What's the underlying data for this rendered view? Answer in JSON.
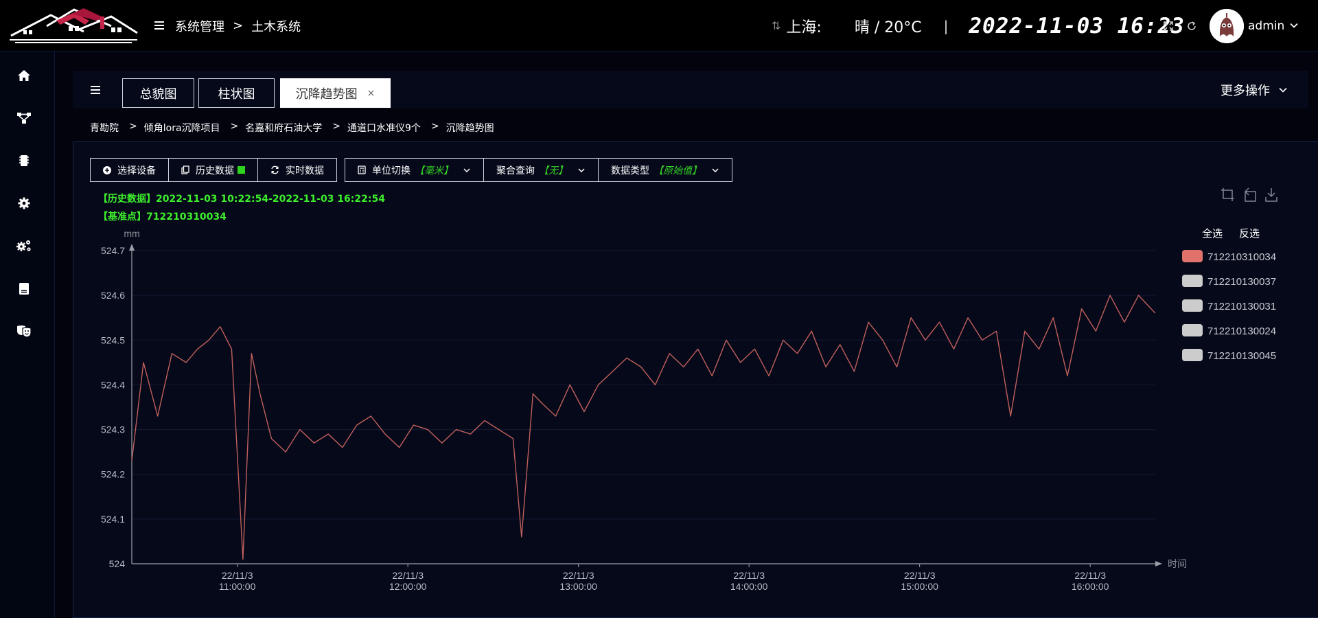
{
  "header": {
    "breadcrumb": [
      "系统管理",
      "土木系统"
    ],
    "breadcrumb_sep": ">",
    "city": "上海:",
    "weather": "晴 / 20°C",
    "divider": "|",
    "clock": "2022-11-03 16:23",
    "user": "admin"
  },
  "sidebar": {
    "items": [
      "home-icon",
      "topology-icon",
      "chip-icon",
      "gear-icon",
      "gears-icon",
      "book-icon",
      "theater-icon"
    ]
  },
  "tabs": {
    "items": [
      {
        "label": "总貌图"
      },
      {
        "label": "柱状图"
      },
      {
        "label": "沉降趋势图"
      }
    ],
    "close": "×",
    "more": "更多操作"
  },
  "breadcrumb": {
    "items": [
      "青勘院",
      "倾角lora沉降项目",
      "名嘉和府石油大学",
      "通道口水准仪9个",
      "沉降趋势图"
    ],
    "sep": ">"
  },
  "toolbar": {
    "select_device": "选择设备",
    "history": "历史数据",
    "realtime": "实时数据",
    "unit_label": "单位切换",
    "unit_value": "【毫米】",
    "agg_label": "聚合查询",
    "agg_value": "【无】",
    "dtype_label": "数据类型",
    "dtype_value": "【原始值】"
  },
  "info": {
    "history_range": "【历史数据】2022-11-03 10:22:54-2022-11-03 16:22:54",
    "reference": "【基准点】712210310034"
  },
  "legend": {
    "select_all": "全选",
    "invert": "反选",
    "items": [
      {
        "name": "712210310034",
        "color": "#e0716b"
      },
      {
        "name": "712210130037",
        "color": "#cccccc"
      },
      {
        "name": "712210130031",
        "color": "#cccccc"
      },
      {
        "name": "712210130024",
        "color": "#cccccc"
      },
      {
        "name": "712210130045",
        "color": "#cccccc"
      }
    ]
  },
  "chart_data": {
    "type": "line",
    "ylabel": "mm",
    "xlabel": "时间",
    "ylim": [
      524,
      524.7
    ],
    "yticks": [
      "524",
      "524.1",
      "524.2",
      "524.3",
      "524.4",
      "524.5",
      "524.6",
      "524.7"
    ],
    "xlim": [
      "2022-11-03 10:22:54",
      "2022-11-03 16:22:54"
    ],
    "xticks": [
      {
        "date": "22/11/3",
        "time": "11:00:00"
      },
      {
        "date": "22/11/3",
        "time": "12:00:00"
      },
      {
        "date": "22/11/3",
        "time": "13:00:00"
      },
      {
        "date": "22/11/3",
        "time": "14:00:00"
      },
      {
        "date": "22/11/3",
        "time": "15:00:00"
      },
      {
        "date": "22/11/3",
        "time": "16:00:00"
      }
    ],
    "series": [
      {
        "name": "712210310034",
        "color": "#c1605c",
        "x": [
          "10:22:54",
          "10:27:00",
          "10:32:00",
          "10:37:00",
          "10:42:00",
          "10:46:00",
          "10:50:00",
          "10:54:00",
          "10:58:00",
          "11:02:00",
          "11:05:00",
          "11:08:00",
          "11:12:00",
          "11:17:00",
          "11:22:00",
          "11:27:00",
          "11:32:00",
          "11:37:00",
          "11:42:00",
          "11:47:00",
          "11:52:00",
          "11:57:00",
          "12:02:00",
          "12:07:00",
          "12:12:00",
          "12:17:00",
          "12:22:00",
          "12:27:00",
          "12:32:00",
          "12:37:00",
          "12:40:00",
          "12:44:00",
          "12:47:00",
          "12:52:00",
          "12:57:00",
          "13:02:00",
          "13:07:00",
          "13:12:00",
          "13:17:00",
          "13:22:00",
          "13:27:00",
          "13:32:00",
          "13:37:00",
          "13:42:00",
          "13:47:00",
          "13:52:00",
          "13:57:00",
          "14:02:00",
          "14:07:00",
          "14:12:00",
          "14:17:00",
          "14:22:00",
          "14:27:00",
          "14:32:00",
          "14:37:00",
          "14:42:00",
          "14:47:00",
          "14:52:00",
          "14:57:00",
          "15:02:00",
          "15:07:00",
          "15:12:00",
          "15:17:00",
          "15:22:00",
          "15:27:00",
          "15:32:00",
          "15:37:00",
          "15:42:00",
          "15:47:00",
          "15:52:00",
          "15:57:00",
          "16:02:00",
          "16:07:00",
          "16:12:00",
          "16:17:00",
          "16:22:54"
        ],
        "y": [
          524.23,
          524.45,
          524.33,
          524.47,
          524.45,
          524.48,
          524.5,
          524.53,
          524.48,
          524.01,
          524.47,
          524.38,
          524.28,
          524.25,
          524.3,
          524.27,
          524.29,
          524.26,
          524.31,
          524.33,
          524.29,
          524.26,
          524.31,
          524.3,
          524.27,
          524.3,
          524.29,
          524.32,
          524.3,
          524.28,
          524.06,
          524.38,
          524.36,
          524.33,
          524.4,
          524.34,
          524.4,
          524.43,
          524.46,
          524.44,
          524.4,
          524.47,
          524.44,
          524.48,
          524.42,
          524.5,
          524.45,
          524.48,
          524.42,
          524.5,
          524.47,
          524.52,
          524.44,
          524.49,
          524.43,
          524.54,
          524.5,
          524.44,
          524.55,
          524.5,
          524.54,
          524.48,
          524.55,
          524.5,
          524.52,
          524.33,
          524.52,
          524.48,
          524.55,
          524.42,
          524.57,
          524.52,
          524.6,
          524.54,
          524.6,
          524.56
        ]
      }
    ]
  }
}
